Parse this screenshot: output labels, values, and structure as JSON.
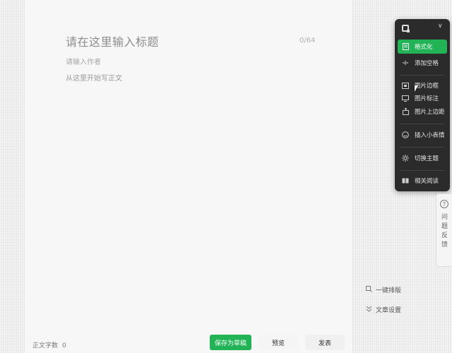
{
  "editor": {
    "title_placeholder": "请在这里输入标题",
    "title_count": "0/64",
    "author_placeholder": "请输入作者",
    "body_placeholder": "从这里开始写正文"
  },
  "toolbar": {
    "collapse_glyph": "∨",
    "items": [
      {
        "label": "格式化",
        "icon": "format-doc-icon",
        "active": true
      },
      {
        "label": "添加空格",
        "icon": "add-space-icon",
        "active": false
      },
      {
        "label": "图片边框",
        "icon": "image-border-icon",
        "active": false
      },
      {
        "label": "图片标注",
        "icon": "image-caption-icon",
        "active": false
      },
      {
        "label": "图片上边距",
        "icon": "image-margin-icon",
        "active": false
      },
      {
        "label": "插入小表情",
        "icon": "emoji-icon",
        "active": false
      },
      {
        "label": "切换主题",
        "icon": "theme-icon",
        "active": false
      },
      {
        "label": "相关阅读",
        "icon": "book-icon",
        "active": false
      }
    ]
  },
  "feedback": {
    "icon_glyph": "?",
    "label": "问题反馈"
  },
  "side_buttons": {
    "one_click_layout": "一键排版",
    "article_settings": "文章设置"
  },
  "footer": {
    "word_count_label": "正文字数",
    "word_count_value": "0",
    "save_draft": "保存为草稿",
    "preview": "预览",
    "publish": "发表"
  },
  "colors": {
    "accent_green": "#21b355",
    "toolbar_bg": "#2b2b2b"
  }
}
